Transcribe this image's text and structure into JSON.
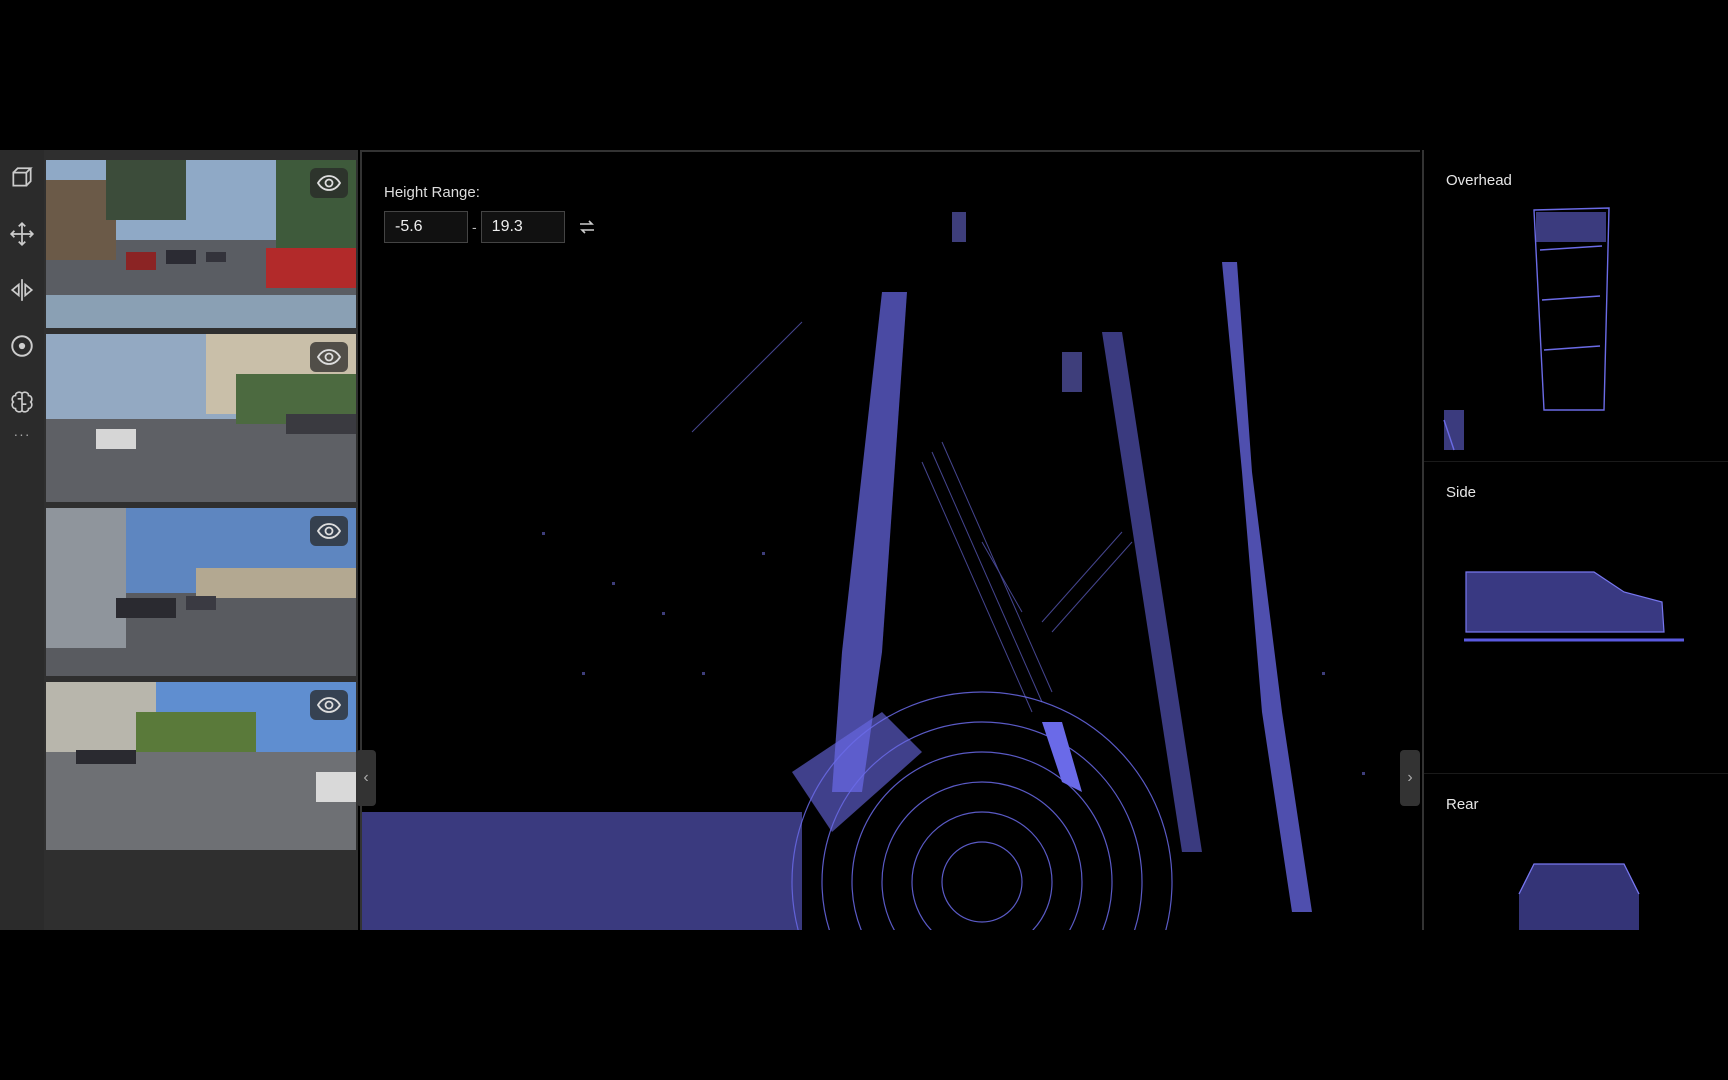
{
  "toolbar": {
    "tools": [
      {
        "name": "cuboid-tool",
        "icon": "cube-icon"
      },
      {
        "name": "move-tool",
        "icon": "move-arrows-icon"
      },
      {
        "name": "mirror-tool",
        "icon": "flip-horizontal-icon"
      },
      {
        "name": "focus-tool",
        "icon": "target-icon"
      },
      {
        "name": "brain-tool",
        "icon": "brain-icon"
      }
    ],
    "more_label": "···"
  },
  "cameras": [
    {
      "name": "camera-front",
      "visibility_icon": "eye-icon"
    },
    {
      "name": "camera-front-left",
      "visibility_icon": "eye-icon"
    },
    {
      "name": "camera-side-left",
      "visibility_icon": "eye-icon"
    },
    {
      "name": "camera-rear-left",
      "visibility_icon": "eye-icon"
    }
  ],
  "viewport": {
    "height_range_label": "Height Range:",
    "min_value": "-5.6",
    "range_separator": "-",
    "max_value": "19.3",
    "swap_icon": "swap-icon",
    "point_color": "#6f6ff0"
  },
  "collapse": {
    "left": "‹",
    "right": "›"
  },
  "mini_views": [
    {
      "title": "Overhead"
    },
    {
      "title": "Side"
    },
    {
      "title": "Rear"
    }
  ],
  "colors": {
    "panel_bg": "#2b2b2b",
    "accent_points": "#7272ff"
  }
}
